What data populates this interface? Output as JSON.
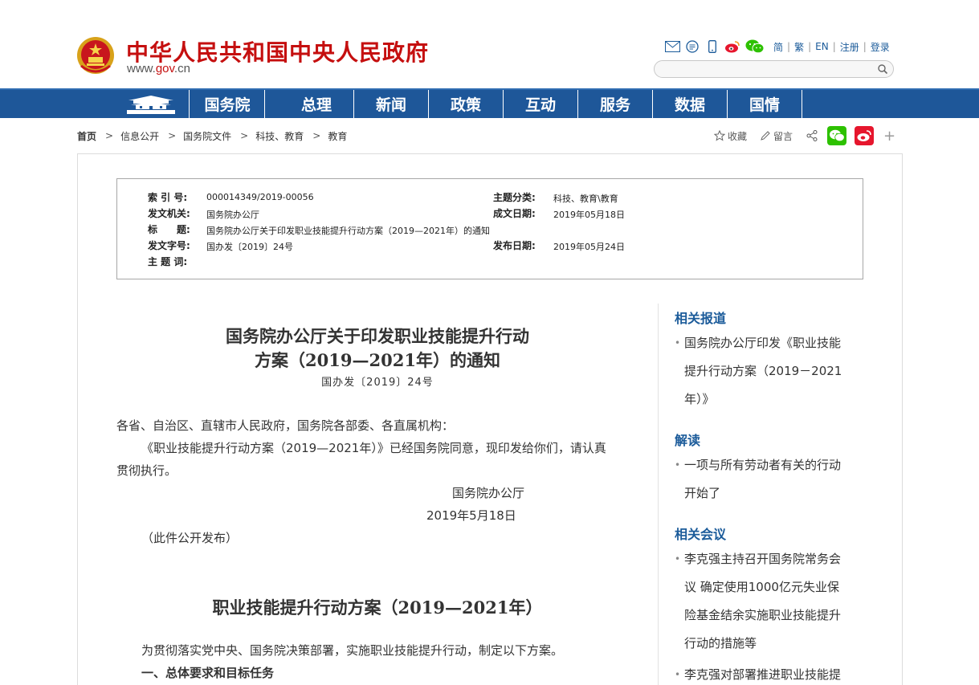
{
  "header": {
    "site_title": "中华人民共和国中央人民政府",
    "site_url_prefix": "www.",
    "site_url_brand": "gov",
    "site_url_suffix": ".cn",
    "links": [
      "简",
      "繁",
      "EN",
      "注册",
      "登录"
    ],
    "icons": [
      "mail-icon",
      "message-icon",
      "mobile-icon",
      "weibo-icon",
      "wechat-icon"
    ],
    "search_placeholder": ""
  },
  "nav": {
    "items": [
      "国务院",
      "总理",
      "新闻",
      "政策",
      "互动",
      "服务",
      "数据",
      "国情"
    ]
  },
  "breadcrumb": [
    "首页",
    "信息公开",
    "国务院文件",
    "科技、教育",
    "教育"
  ],
  "tools": {
    "favorite": "收藏",
    "comment": "留言"
  },
  "meta": {
    "index_label": "索 引 号:",
    "index_value": "000014349/2019-00056",
    "category_label": "主题分类:",
    "category_value": "科技、教育\\教育",
    "issuer_label": "发文机关:",
    "issuer_value": "国务院办公厅",
    "created_label": "成文日期:",
    "created_value": "2019年05月18日",
    "title_label": "标　　题:",
    "title_value": "国务院办公厅关于印发职业技能提升行动方案（2019—2021年）的通知",
    "docno_label": "发文字号:",
    "docno_value": "国办发〔2019〕24号",
    "published_label": "发布日期:",
    "published_value": "2019年05月24日",
    "keywords_label": "主 题 词:"
  },
  "article": {
    "title_line1": "国务院办公厅关于印发职业技能提升行动",
    "title_line2": "方案（2019—2021年）的通知",
    "doc_number": "国办发〔2019〕24号",
    "greeting": "各省、自治区、直辖市人民政府，国务院各部委、各直属机构：",
    "body_line1": "《职业技能提升行动方案（2019—2021年）》已经国务院同意，现印发给你们，请认真",
    "body_line2": "贯彻执行。",
    "signer": "国务院办公厅",
    "date": "2019年5月18日",
    "disclosure": "（此件公开发布）",
    "plan_title": "职业技能提升行动方案（2019—2021年）",
    "plan_intro": "为贯彻落实党中央、国务院决策部署，实施职业技能提升行动，制定以下方案。",
    "section1": "一、总体要求和目标任务"
  },
  "sidebar": {
    "related_reports": "相关报道",
    "report1_lines": [
      "国务院办公厅印发《职业技能",
      "提升行动方案（2019－2021",
      "年）》"
    ],
    "interpretation": "解读",
    "interp1_lines": [
      "一项与所有劳动者有关的行动",
      "开始了"
    ],
    "related_meetings": "相关会议",
    "meeting1_lines": [
      "李克强主持召开国务院常务会",
      "议 确定使用1000亿元失业保",
      "险基金结余实施职业技能提升",
      "行动的措施等"
    ],
    "meeting2_lines": [
      "李克强对部署推进职业技能提"
    ]
  },
  "colors": {
    "brand_red": "#c50f0f",
    "nav_blue": "#1e5799",
    "link_blue": "#1b5b9a",
    "wechat_green": "#2dc100",
    "weibo_red": "#e6162d"
  }
}
